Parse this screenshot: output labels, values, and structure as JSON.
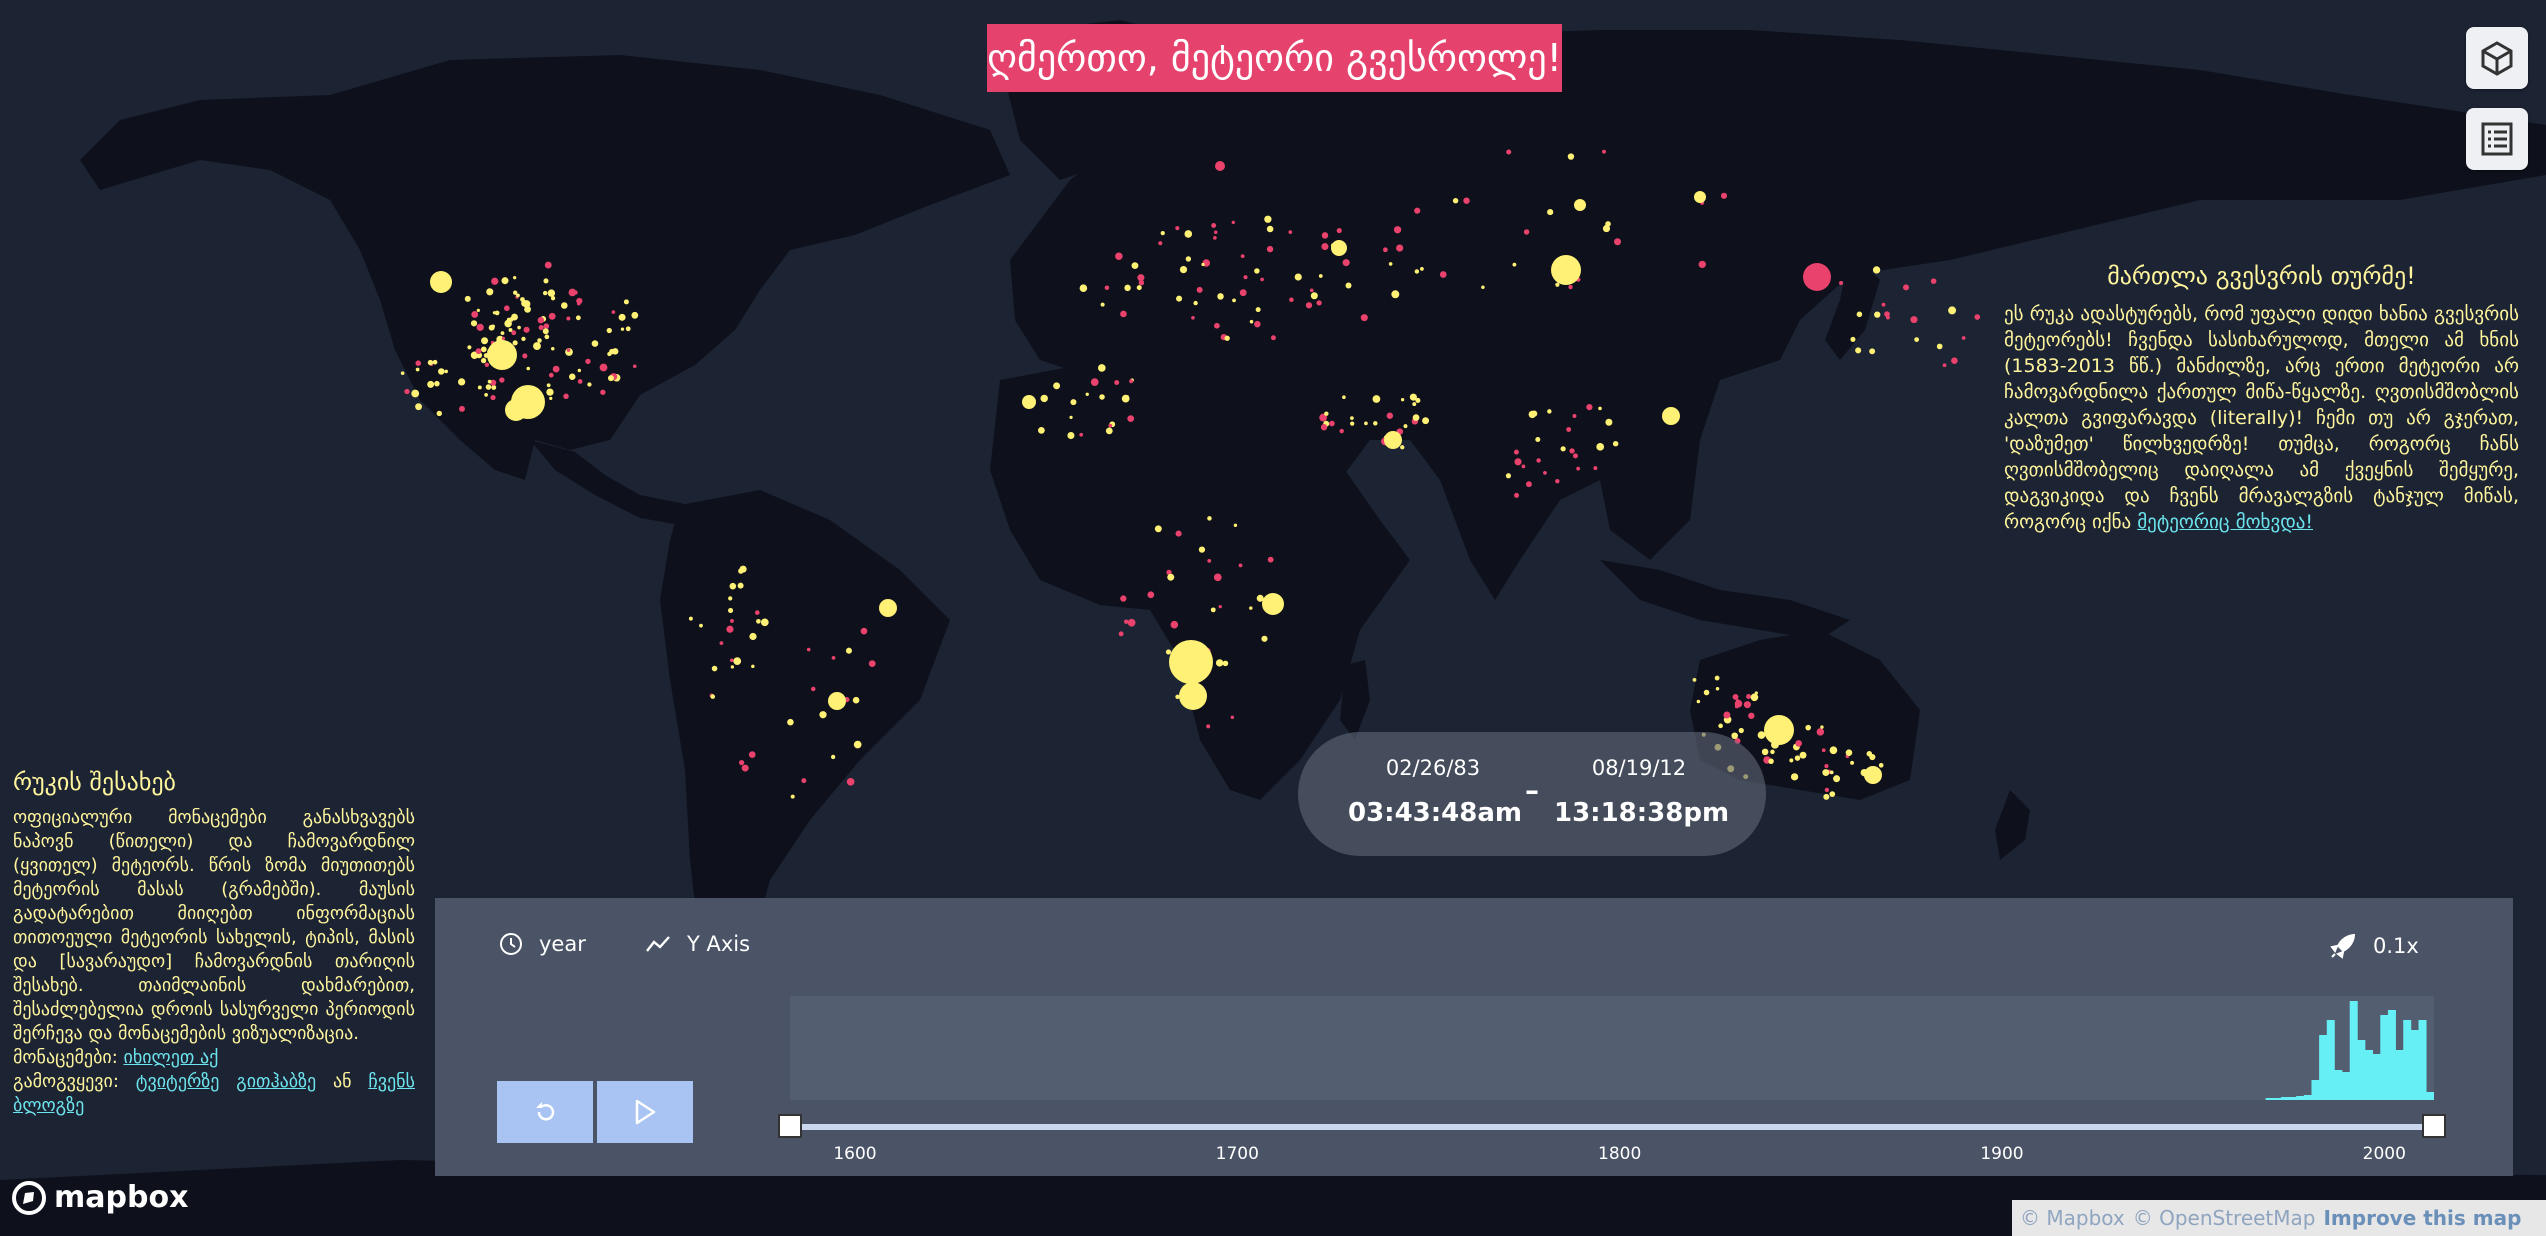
{
  "title": "ღმერთო, მეტეორი გვესროლე!",
  "colors": {
    "ocean": "#1c2333",
    "land": "#0e111b",
    "found_meteorite": "#fff176",
    "fell_meteorite": "#e8426d",
    "banner": "#e5426d",
    "panel_text": "#fff59d",
    "link": "#6de5ef",
    "histogram_bar": "#66f0f5"
  },
  "controls": {
    "view_3d_icon": "cube-icon",
    "list_icon": "list-icon"
  },
  "side_panel": {
    "heading": "მართლა გვესვრის თურმე!",
    "body": "ეს რუკა ადასტურებს, რომ უფალი დიდი ხანია გვესვრის მეტეორებს! ჩვენდა სასიხარულოდ, მთელი ამ ხნის (1583-2013 წწ.) მანძილზე, არც ერთი მეტეორი არ ჩამოვარდნილა ქართულ მიწა-წყალზე. ღვთისმშობლის კალთა გვიფარავდა (literally)! ჩემი თუ არ გჯერათ, 'დაზუმეთ' წილხვედრზე! თუმცა, როგორც ჩანს ღვთისმშობელიც დაიღალა ამ ქვეყნის შემყურე, დაგვიკიდა და ჩვენს მრავალგზის ტანჯულ მიწას, როგორც იქნა",
    "link_text": "მეტეორიც მოხვდა!"
  },
  "about_panel": {
    "heading": "რუკის შესახებ",
    "body": "ოფიციალური მონაცემები განასხვავებს ნაპოვნ (წითელი) და ჩამოვარდნილ (ყვითელ) მეტეორს. წრის ზომა მიუთითებს მეტეორის მასას (გრამებში). მაუსის გადატარებით მიიღებთ ინფორმაციას თითოეული მეტეორის სახელის, ტიპის, მასის და [სავარაუდო] ჩამოვარდნის თარიღის შესახებ. თაიმლაინის დახმარებით, შესაძლებელია დროის სასურველი პერიოდის შერჩევა და მონაცემების ვიზუალიზაცია.",
    "data_label": "მონაცემები:",
    "data_link": "იხილეთ აქ",
    "follow_label": "გამოგვყევი:",
    "twitter_link": "ტვიტერზე",
    "github_link": "გითჰაბზე",
    "or_label": "ან",
    "blog_link": "ჩვენს ბლოგზე"
  },
  "date_range": {
    "start_date": "02/26/83",
    "start_time": "03:43:48am",
    "separator": "–",
    "end_date": "08/19/12",
    "end_time": "13:18:38pm"
  },
  "timeline": {
    "interval_label": "year",
    "axis_label": "Y Axis",
    "speed_label": "0.1x",
    "icons": {
      "clock": "clock-icon",
      "axis": "trend-line-icon",
      "speed": "rocket-icon",
      "replay": "replay-icon",
      "play": "play-icon"
    },
    "axis_years": [
      "1600",
      "1700",
      "1800",
      "1900",
      "2000"
    ],
    "range": {
      "start_year": 1583,
      "end_year": 2013
    },
    "histogram": {
      "x": [
        1970,
        1972,
        1974,
        1976,
        1978,
        1980,
        1982,
        1984,
        1986,
        1988,
        1990,
        1992,
        1994,
        1996,
        1998,
        2000,
        2002,
        2004,
        2006,
        2008,
        2010,
        2012
      ],
      "values": [
        2,
        2,
        3,
        3,
        4,
        5,
        20,
        65,
        80,
        30,
        28,
        99,
        60,
        50,
        46,
        85,
        90,
        50,
        80,
        70,
        80,
        8
      ],
      "y_max": 100
    }
  },
  "mapbox_logo": "mapbox",
  "attribution": {
    "mapbox": "© Mapbox",
    "osm": "© OpenStreetMap",
    "improve": "Improve this map"
  }
}
